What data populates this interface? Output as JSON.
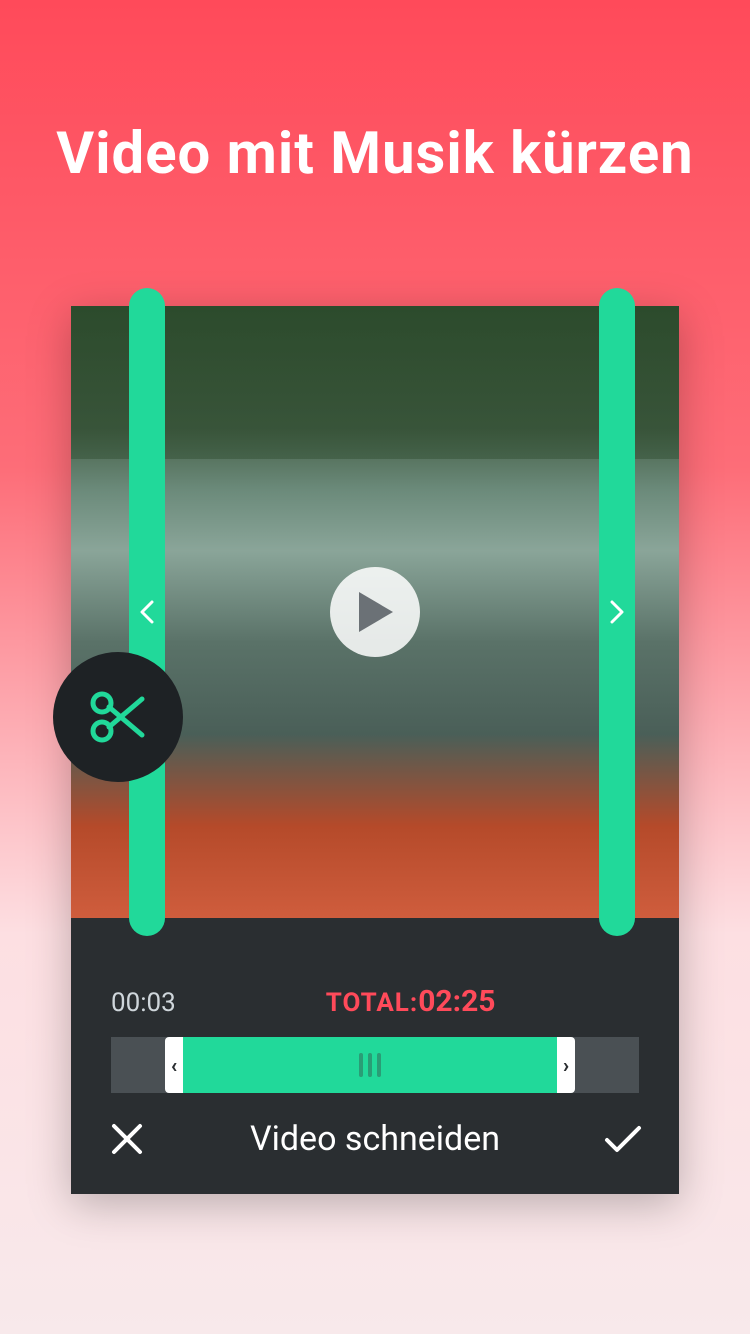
{
  "header": {
    "title": "Video mit Musik kürzen"
  },
  "editor": {
    "play_icon": "play-icon",
    "trim_left_icon": "chevron-left-icon",
    "trim_right_icon": "chevron-right-icon",
    "cut_icon": "scissors-icon"
  },
  "timeline": {
    "current_time": "00:03",
    "total_label": "TOTAL:",
    "total_time": "02:25"
  },
  "footer": {
    "cancel_icon": "close-icon",
    "title": "Video schneiden",
    "confirm_icon": "check-icon"
  },
  "colors": {
    "accent": "#21d99a",
    "danger": "#ff4a5a",
    "panel": "#2a2e31"
  }
}
